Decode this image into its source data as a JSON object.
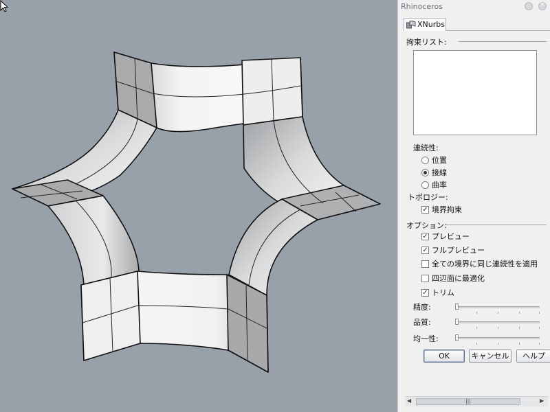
{
  "panel": {
    "window_title": "Rhinoceros",
    "close_glyph": "×",
    "tab_label": "XNurbs",
    "constraint_list_label": "拘束リスト:",
    "continuity_label": "連続性:",
    "continuity_options": [
      "位置",
      "接線",
      "曲率"
    ],
    "continuity_selected_index": 1,
    "topology_label": "トポロジー:",
    "boundary_constraint_label": "境界拘束",
    "boundary_constraint_checked": true,
    "options_label": "オプション:",
    "options": [
      {
        "label": "プレビュー",
        "checked": true
      },
      {
        "label": "フルプレビュー",
        "checked": true
      },
      {
        "label": "全ての境界に同じ連続性を適用",
        "checked": false
      },
      {
        "label": "四辺面に最適化",
        "checked": false
      },
      {
        "label": "トリム",
        "checked": true
      }
    ],
    "sliders": [
      {
        "label": "精度:",
        "value": 0
      },
      {
        "label": "品質:",
        "value": 0
      },
      {
        "label": "均一性:",
        "value": 0
      }
    ],
    "ok_label": "OK",
    "cancel_label": "キャンセル",
    "help_label": "ヘルプ",
    "scroll_thumb_glyph": "|||",
    "check_glyph": "✓"
  },
  "colors": {
    "viewport_bg": "#98a0a9",
    "panel_bg": "#f0f0f0"
  },
  "icons": [
    "xnurbs-tab-icon",
    "settings-icon",
    "close-icon",
    "mouse-cursor-icon"
  ]
}
